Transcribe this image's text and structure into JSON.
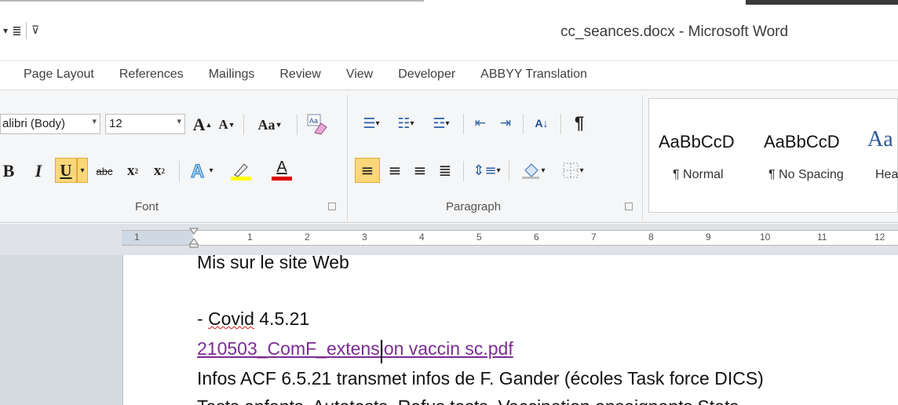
{
  "window": {
    "title": "cc_seances.docx - Microsoft Word",
    "qat_icons": [
      "align-icon",
      "customize-qat-icon"
    ]
  },
  "tabs": [
    "Page Layout",
    "References",
    "Mailings",
    "Review",
    "View",
    "Developer",
    "ABBYY Translation"
  ],
  "ribbon": {
    "font": {
      "name": "alibri (Body)",
      "size": "12",
      "label": "Font",
      "grow_label": "A",
      "shrink_label": "A",
      "change_case_label": "Aa",
      "bold_label": "B",
      "italic_label": "I",
      "underline_label": "U",
      "strikethrough_label": "abc",
      "subscript_label": "x",
      "superscript_label": "x",
      "font_color_label": "A",
      "highlight_color": "#ffff00",
      "font_color": "#e00000"
    },
    "paragraph": {
      "label": "Paragraph",
      "show_marks_label": "¶"
    },
    "styles": [
      {
        "sample": "AaBbCcD",
        "name": "¶ Normal"
      },
      {
        "sample": "AaBbCcD",
        "name": "¶ No Spacing"
      },
      {
        "sample": "Aa",
        "name": "Hea"
      }
    ]
  },
  "ruler": {
    "labels": [
      "1",
      "1",
      "2",
      "3",
      "4",
      "5",
      "6",
      "7",
      "8",
      "9",
      "10",
      "11",
      "12"
    ]
  },
  "document": {
    "lines": [
      "Mis sur le site Web",
      "- Covid 4.5.21",
      "210503_ComF_extension vaccin sc.pdf",
      "Infos ACF 6.5.21 transmet infos de F. Gander (écoles Task force DICS)",
      "Tests enfants, Autotests, Refus tests, Vaccination enseignants Stats"
    ],
    "link_color": "#7b2c91"
  }
}
